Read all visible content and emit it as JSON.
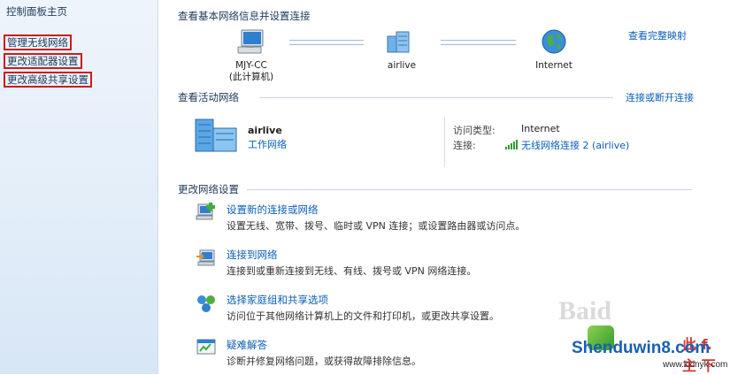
{
  "sidebar": {
    "home": "控制面板主页",
    "items": [
      "管理无线网络",
      "更改适配器设置",
      "更改高级共享设置"
    ]
  },
  "header": {
    "title": "查看基本网络信息并设置连接",
    "full_map": "查看完整映射"
  },
  "map": {
    "computer": "MJY-CC",
    "computer_sub": "(此计算机)",
    "network": "airlive",
    "internet": "Internet"
  },
  "active": {
    "title": "查看活动网络",
    "connect_link": "连接或断开连接",
    "network_name": "airlive",
    "network_type": "工作网络",
    "access_type_label": "访问类型:",
    "access_type_value": "Internet",
    "connection_label": "连接:",
    "connection_value": "无线网络连接 2 (airlive)"
  },
  "change": {
    "title": "更改网络设置",
    "tasks": [
      {
        "title": "设置新的连接或网络",
        "desc": "设置无线、宽带、拨号、临时或 VPN 连接；或设置路由器或访问点。"
      },
      {
        "title": "连接到网络",
        "desc": "连接到或重新连接到无线、有线、拨号或 VPN 网络连接。"
      },
      {
        "title": "选择家庭组和共享选项",
        "desc": "访问位于其他网络计算机上的文件和打印机，或更改共享设置。"
      },
      {
        "title": "疑难解答",
        "desc": "诊断并修复网络问题，或获得故障排除信息。"
      }
    ]
  },
  "watermark": {
    "baidu": "Baid",
    "site": "Shenduwin8.com",
    "url": "www.kxinyk.com",
    "cn": "此 f. 主 下"
  }
}
